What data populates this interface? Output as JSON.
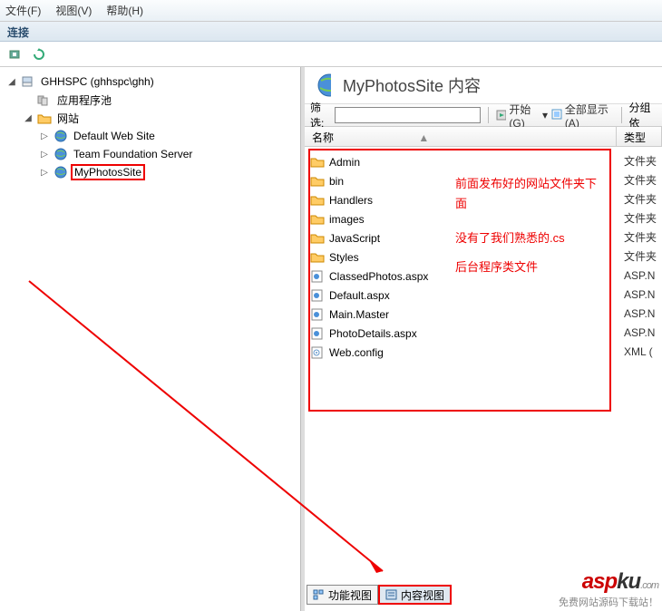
{
  "menu": {
    "file": "文件(F)",
    "view": "视图(V)",
    "help": "帮助(H)"
  },
  "conn": {
    "header": "连接"
  },
  "tree": {
    "root": "GHHSPC (ghhspc\\ghh)",
    "apppool": "应用程序池",
    "sites": "网站",
    "site1": "Default Web Site",
    "site2": "Team Foundation Server",
    "site3": "MyPhotosSite"
  },
  "page": {
    "title": "MyPhotosSite 内容",
    "filter_label": "筛选:",
    "filter_value": "",
    "start": "开始(G)",
    "showall": "全部显示(A)",
    "groupby": "分组依"
  },
  "cols": {
    "name": "名称",
    "type": "类型"
  },
  "files": [
    {
      "name": "Admin",
      "kind": "folder",
      "type": "文件夹"
    },
    {
      "name": "bin",
      "kind": "folder",
      "type": "文件夹"
    },
    {
      "name": "Handlers",
      "kind": "folder",
      "type": "文件夹"
    },
    {
      "name": "images",
      "kind": "folder",
      "type": "文件夹"
    },
    {
      "name": "JavaScript",
      "kind": "folder",
      "type": "文件夹"
    },
    {
      "name": "Styles",
      "kind": "folder",
      "type": "文件夹"
    },
    {
      "name": "ClassedPhotos.aspx",
      "kind": "aspx",
      "type": "ASP.N"
    },
    {
      "name": "Default.aspx",
      "kind": "aspx",
      "type": "ASP.N"
    },
    {
      "name": "Main.Master",
      "kind": "aspx",
      "type": "ASP.N"
    },
    {
      "name": "PhotoDetails.aspx",
      "kind": "aspx",
      "type": "ASP.N"
    },
    {
      "name": "Web.config",
      "kind": "config",
      "type": "XML ("
    }
  ],
  "annotation": {
    "line1": "前面发布好的网站文件夹下面",
    "line2": "没有了我们熟悉的.cs",
    "line3": "后台程序类文件"
  },
  "tabs": {
    "features": "功能视图",
    "content": "内容视图"
  },
  "watermark": {
    "brand_a": "asp",
    "brand_b": "ku",
    "dom": ".com",
    "sub": "免费网站源码下载站！"
  }
}
